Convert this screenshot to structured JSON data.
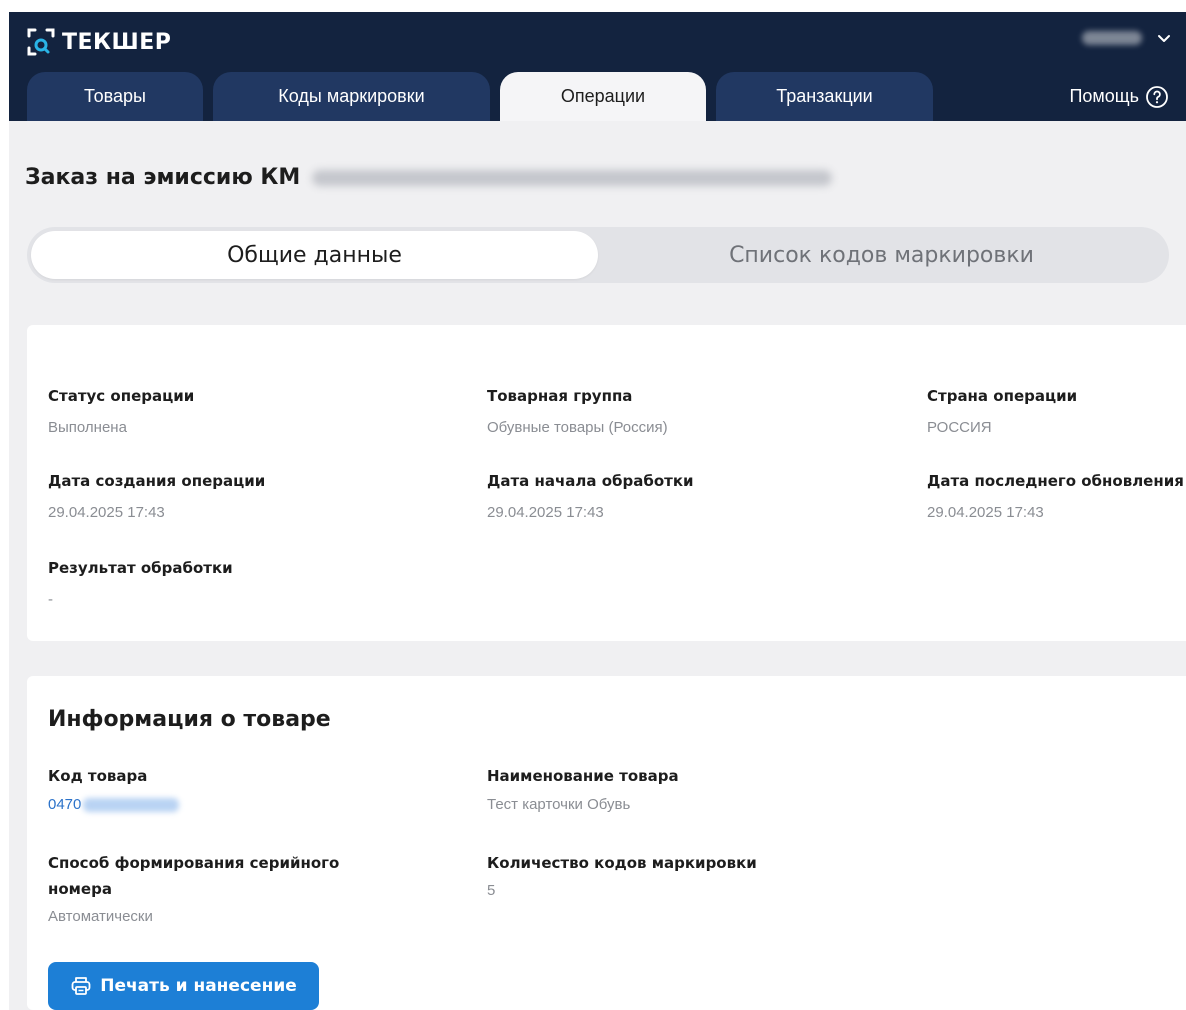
{
  "brand": {
    "name": "ТЕКШЕР",
    "logo_icon": "search-bracket-icon"
  },
  "user": {
    "name_hidden": true,
    "menu_icon": "chevron-down-icon"
  },
  "nav": {
    "tabs": [
      {
        "label": "Товары",
        "active": false
      },
      {
        "label": "Коды маркировки",
        "active": false
      },
      {
        "label": "Операции",
        "active": true
      },
      {
        "label": "Транзакции",
        "active": false
      }
    ],
    "help_label": "Помощь",
    "help_icon": "question-circle-icon"
  },
  "page": {
    "title": "Заказ на эмиссию КМ"
  },
  "subtabs": [
    {
      "label": "Общие данные",
      "active": true
    },
    {
      "label": "Список кодов маркировки",
      "active": false
    }
  ],
  "general": {
    "status_label": "Статус операции",
    "status_value": "Выполнена",
    "group_label": "Товарная группа",
    "group_value": "Обувные товары (Россия)",
    "country_label": "Страна операции",
    "country_value": "РОССИЯ",
    "created_label": "Дата создания операции",
    "created_value": "29.04.2025 17:43",
    "started_label": "Дата начала обработки",
    "started_value": "29.04.2025 17:43",
    "updated_label": "Дата последнего обновления",
    "updated_value": "29.04.2025 17:43",
    "result_label": "Результат обработки",
    "result_value": "-"
  },
  "product": {
    "section_title": "Информация о товаре",
    "code_label": "Код товара",
    "code_value": "0470",
    "name_label": "Наименование товара",
    "name_value": "Тест карточки Обувь",
    "serial_label": "Способ формирования серийного номера",
    "serial_value": "Автоматически",
    "count_label": "Количество кодов маркировки",
    "count_value": "5",
    "print_button": "Печать и нанесение",
    "print_icon": "printer-icon"
  },
  "colors": {
    "header_bg": "#13233f",
    "tab_bg": "#213862",
    "accent": "#1d7fd6",
    "link": "#2b72c9"
  }
}
